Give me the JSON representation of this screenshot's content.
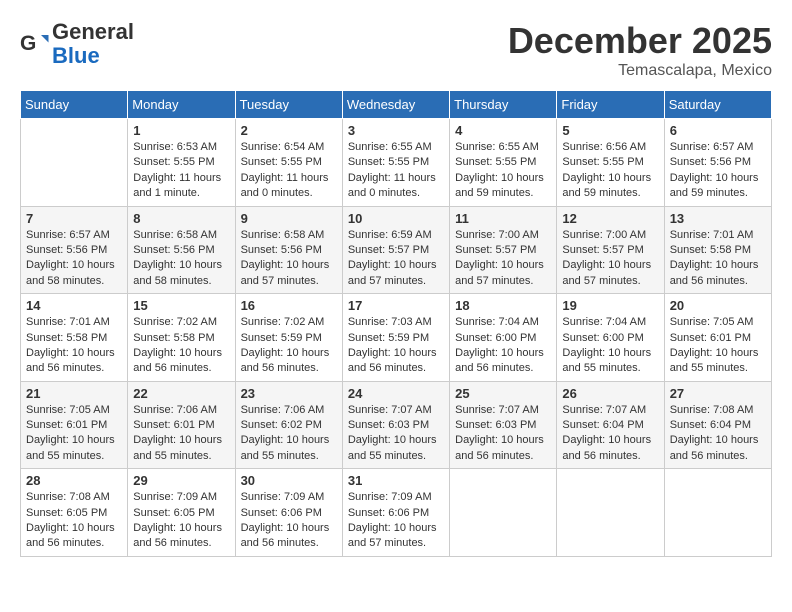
{
  "logo": {
    "text_general": "General",
    "text_blue": "Blue"
  },
  "title": "December 2025",
  "location": "Temascalapa, Mexico",
  "headers": [
    "Sunday",
    "Monday",
    "Tuesday",
    "Wednesday",
    "Thursday",
    "Friday",
    "Saturday"
  ],
  "weeks": [
    [
      {
        "day": "",
        "info": ""
      },
      {
        "day": "1",
        "info": "Sunrise: 6:53 AM\nSunset: 5:55 PM\nDaylight: 11 hours\nand 1 minute."
      },
      {
        "day": "2",
        "info": "Sunrise: 6:54 AM\nSunset: 5:55 PM\nDaylight: 11 hours\nand 0 minutes."
      },
      {
        "day": "3",
        "info": "Sunrise: 6:55 AM\nSunset: 5:55 PM\nDaylight: 11 hours\nand 0 minutes."
      },
      {
        "day": "4",
        "info": "Sunrise: 6:55 AM\nSunset: 5:55 PM\nDaylight: 10 hours\nand 59 minutes."
      },
      {
        "day": "5",
        "info": "Sunrise: 6:56 AM\nSunset: 5:55 PM\nDaylight: 10 hours\nand 59 minutes."
      },
      {
        "day": "6",
        "info": "Sunrise: 6:57 AM\nSunset: 5:56 PM\nDaylight: 10 hours\nand 59 minutes."
      }
    ],
    [
      {
        "day": "7",
        "info": "Sunrise: 6:57 AM\nSunset: 5:56 PM\nDaylight: 10 hours\nand 58 minutes."
      },
      {
        "day": "8",
        "info": "Sunrise: 6:58 AM\nSunset: 5:56 PM\nDaylight: 10 hours\nand 58 minutes."
      },
      {
        "day": "9",
        "info": "Sunrise: 6:58 AM\nSunset: 5:56 PM\nDaylight: 10 hours\nand 57 minutes."
      },
      {
        "day": "10",
        "info": "Sunrise: 6:59 AM\nSunset: 5:57 PM\nDaylight: 10 hours\nand 57 minutes."
      },
      {
        "day": "11",
        "info": "Sunrise: 7:00 AM\nSunset: 5:57 PM\nDaylight: 10 hours\nand 57 minutes."
      },
      {
        "day": "12",
        "info": "Sunrise: 7:00 AM\nSunset: 5:57 PM\nDaylight: 10 hours\nand 57 minutes."
      },
      {
        "day": "13",
        "info": "Sunrise: 7:01 AM\nSunset: 5:58 PM\nDaylight: 10 hours\nand 56 minutes."
      }
    ],
    [
      {
        "day": "14",
        "info": "Sunrise: 7:01 AM\nSunset: 5:58 PM\nDaylight: 10 hours\nand 56 minutes."
      },
      {
        "day": "15",
        "info": "Sunrise: 7:02 AM\nSunset: 5:58 PM\nDaylight: 10 hours\nand 56 minutes."
      },
      {
        "day": "16",
        "info": "Sunrise: 7:02 AM\nSunset: 5:59 PM\nDaylight: 10 hours\nand 56 minutes."
      },
      {
        "day": "17",
        "info": "Sunrise: 7:03 AM\nSunset: 5:59 PM\nDaylight: 10 hours\nand 56 minutes."
      },
      {
        "day": "18",
        "info": "Sunrise: 7:04 AM\nSunset: 6:00 PM\nDaylight: 10 hours\nand 56 minutes."
      },
      {
        "day": "19",
        "info": "Sunrise: 7:04 AM\nSunset: 6:00 PM\nDaylight: 10 hours\nand 55 minutes."
      },
      {
        "day": "20",
        "info": "Sunrise: 7:05 AM\nSunset: 6:01 PM\nDaylight: 10 hours\nand 55 minutes."
      }
    ],
    [
      {
        "day": "21",
        "info": "Sunrise: 7:05 AM\nSunset: 6:01 PM\nDaylight: 10 hours\nand 55 minutes."
      },
      {
        "day": "22",
        "info": "Sunrise: 7:06 AM\nSunset: 6:01 PM\nDaylight: 10 hours\nand 55 minutes."
      },
      {
        "day": "23",
        "info": "Sunrise: 7:06 AM\nSunset: 6:02 PM\nDaylight: 10 hours\nand 55 minutes."
      },
      {
        "day": "24",
        "info": "Sunrise: 7:07 AM\nSunset: 6:03 PM\nDaylight: 10 hours\nand 55 minutes."
      },
      {
        "day": "25",
        "info": "Sunrise: 7:07 AM\nSunset: 6:03 PM\nDaylight: 10 hours\nand 56 minutes."
      },
      {
        "day": "26",
        "info": "Sunrise: 7:07 AM\nSunset: 6:04 PM\nDaylight: 10 hours\nand 56 minutes."
      },
      {
        "day": "27",
        "info": "Sunrise: 7:08 AM\nSunset: 6:04 PM\nDaylight: 10 hours\nand 56 minutes."
      }
    ],
    [
      {
        "day": "28",
        "info": "Sunrise: 7:08 AM\nSunset: 6:05 PM\nDaylight: 10 hours\nand 56 minutes."
      },
      {
        "day": "29",
        "info": "Sunrise: 7:09 AM\nSunset: 6:05 PM\nDaylight: 10 hours\nand 56 minutes."
      },
      {
        "day": "30",
        "info": "Sunrise: 7:09 AM\nSunset: 6:06 PM\nDaylight: 10 hours\nand 56 minutes."
      },
      {
        "day": "31",
        "info": "Sunrise: 7:09 AM\nSunset: 6:06 PM\nDaylight: 10 hours\nand 57 minutes."
      },
      {
        "day": "",
        "info": ""
      },
      {
        "day": "",
        "info": ""
      },
      {
        "day": "",
        "info": ""
      }
    ]
  ]
}
